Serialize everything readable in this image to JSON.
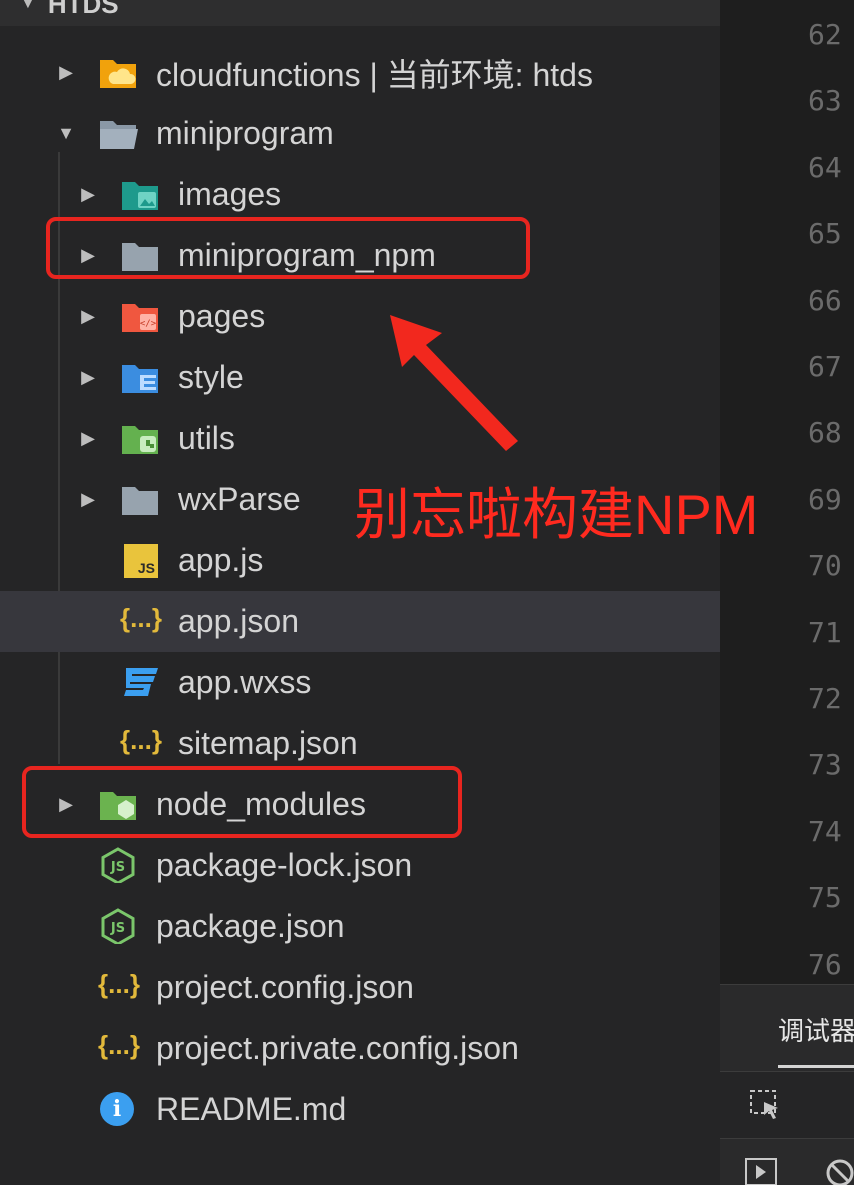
{
  "explorer": {
    "section_title": "HTDS",
    "items": [
      {
        "label": "cloudfunctions | 当前环境: htds",
        "icon": "cloud-folder-icon"
      },
      {
        "label": "miniprogram",
        "icon": "folder-open-icon"
      },
      {
        "label": "images",
        "icon": "images-folder-icon"
      },
      {
        "label": "miniprogram_npm",
        "icon": "folder-icon"
      },
      {
        "label": "pages",
        "icon": "pages-folder-icon"
      },
      {
        "label": "style",
        "icon": "style-folder-icon"
      },
      {
        "label": "utils",
        "icon": "utils-folder-icon"
      },
      {
        "label": "wxParse",
        "icon": "folder-icon"
      },
      {
        "label": "app.js",
        "icon": "js-file-icon",
        "glyph": "JS"
      },
      {
        "label": "app.json",
        "icon": "json-file-icon",
        "glyph": "{...}"
      },
      {
        "label": "app.wxss",
        "icon": "css-file-icon"
      },
      {
        "label": "sitemap.json",
        "icon": "json-file-icon",
        "glyph": "{...}"
      },
      {
        "label": "node_modules",
        "icon": "node-modules-folder-icon"
      },
      {
        "label": "package-lock.json",
        "icon": "nodejs-file-icon"
      },
      {
        "label": "package.json",
        "icon": "nodejs-file-icon"
      },
      {
        "label": "project.config.json",
        "icon": "json-file-icon",
        "glyph": "{...}"
      },
      {
        "label": "project.private.config.json",
        "icon": "json-file-icon",
        "glyph": "{...}"
      },
      {
        "label": "README.md",
        "icon": "info-icon",
        "glyph": "i"
      }
    ]
  },
  "editor": {
    "line_numbers": [
      "62",
      "63",
      "64",
      "65",
      "66",
      "67",
      "68",
      "69",
      "70",
      "71",
      "72",
      "73",
      "74",
      "75",
      "76"
    ]
  },
  "debug_panel": {
    "tab_label": "调试器"
  },
  "annotation": {
    "text": "别忘啦构建NPM"
  },
  "colors": {
    "accent_red": "#e8251f",
    "json_icon": "#e2b93b",
    "info_blue": "#3b9ff0",
    "node_green": "#7bc66b"
  }
}
